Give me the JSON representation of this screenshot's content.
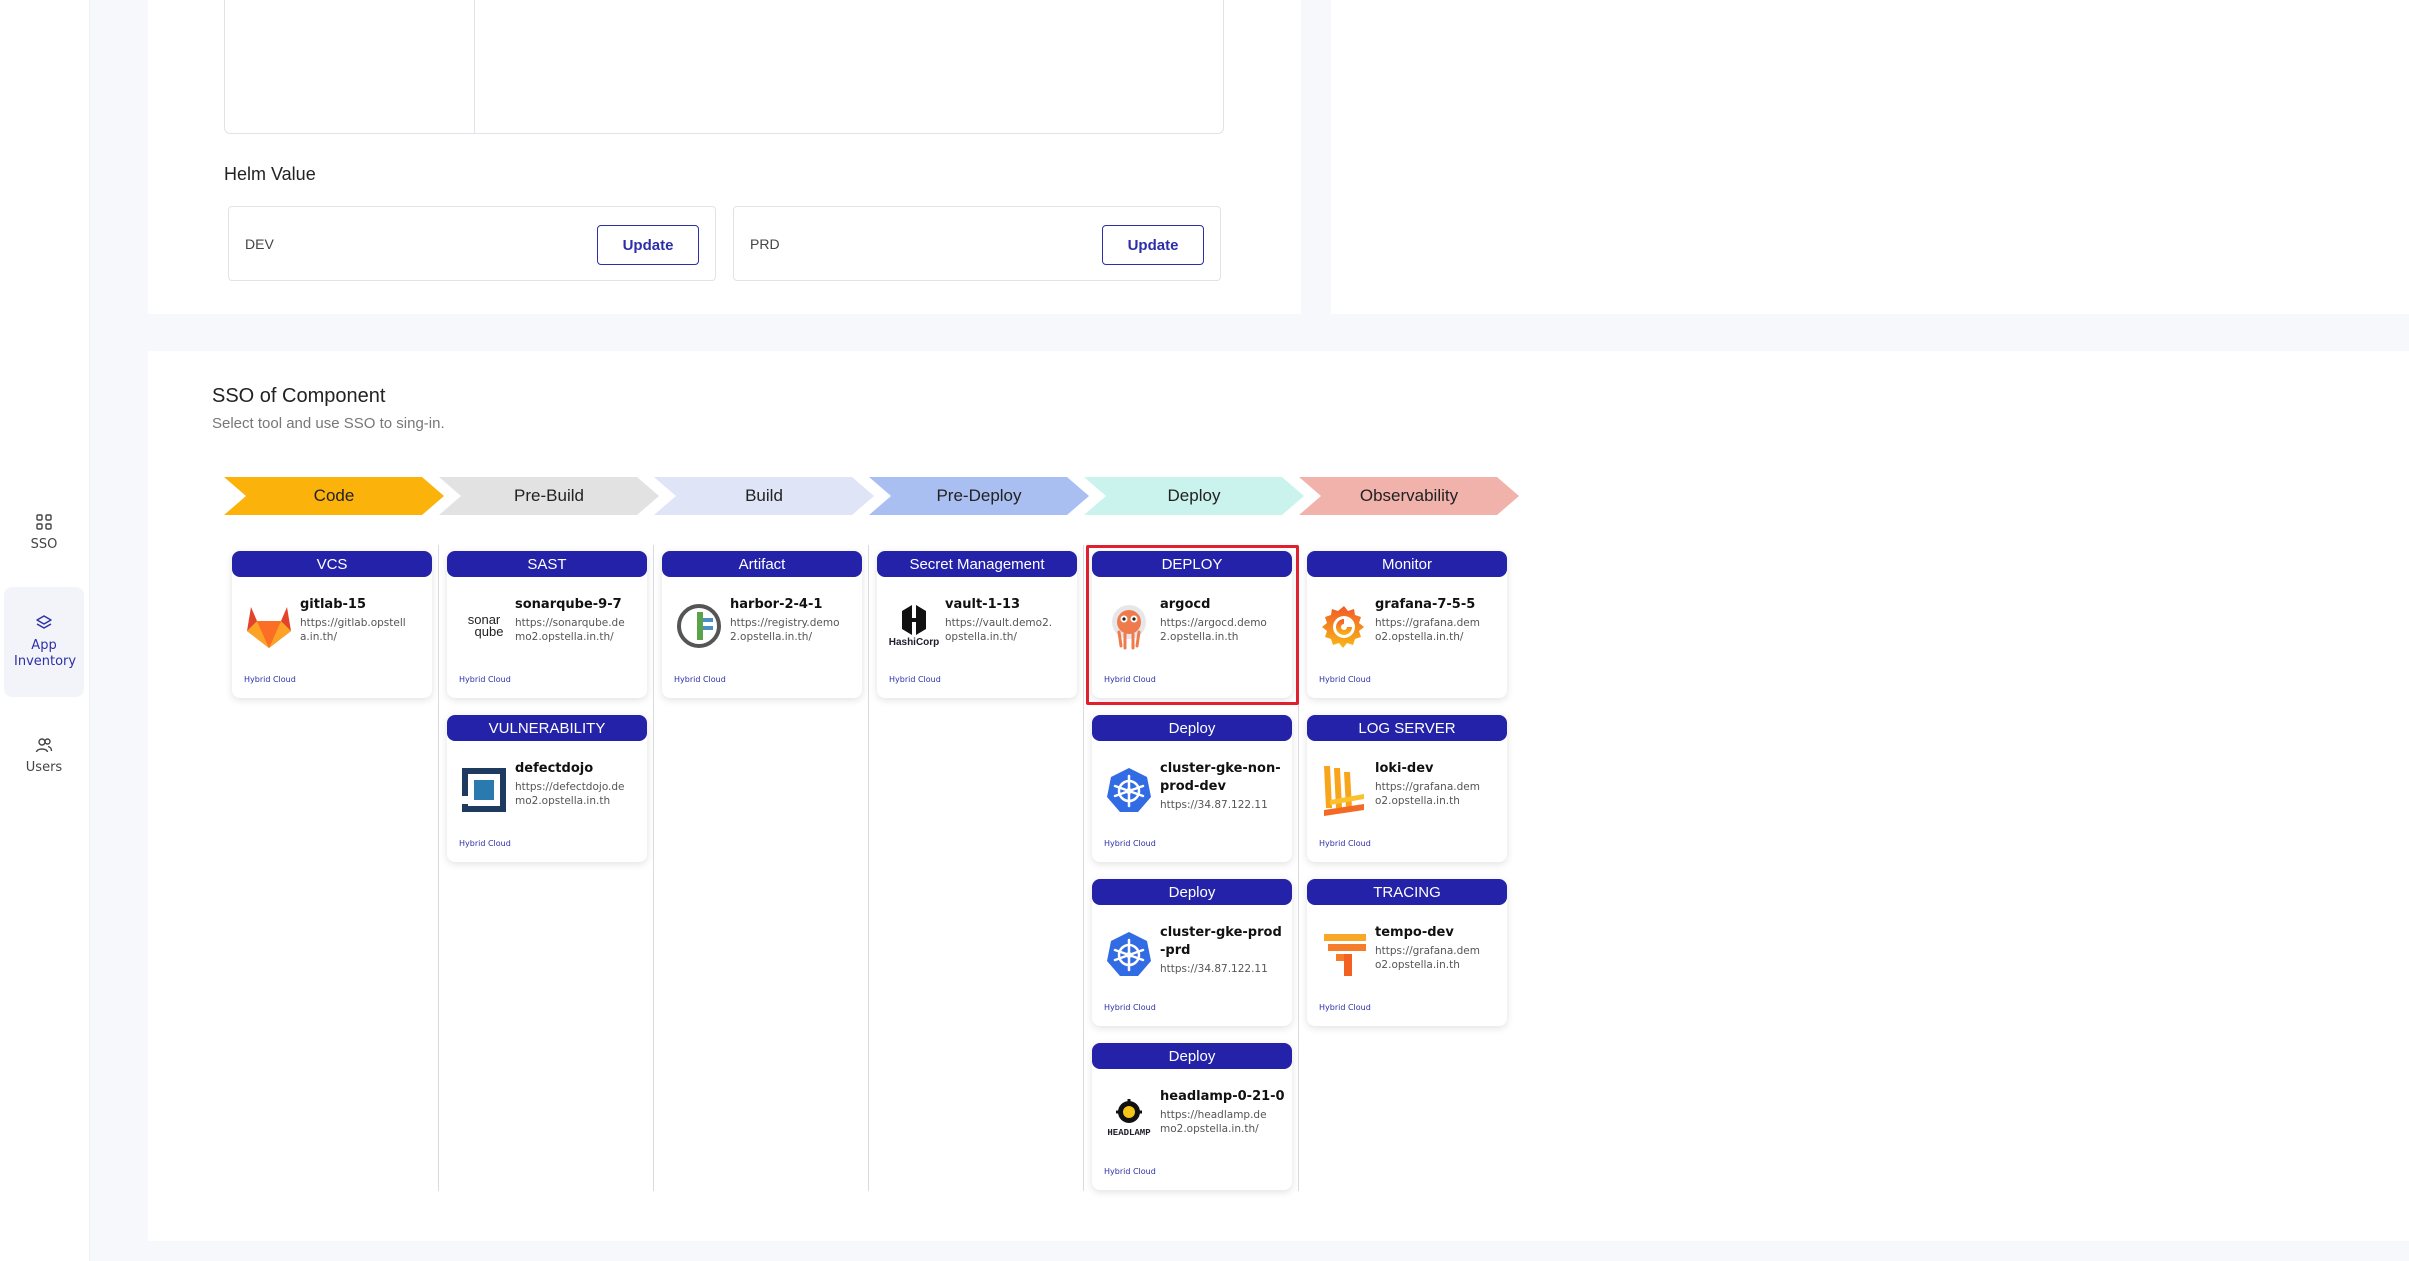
{
  "sidebar": {
    "items": [
      {
        "label": "SSO",
        "icon": "grid-icon"
      },
      {
        "label": "App Inventory",
        "icon": "layers-icon"
      },
      {
        "label": "Users",
        "icon": "users-icon"
      }
    ]
  },
  "helm": {
    "title": "Helm Value",
    "envs": [
      {
        "name": "DEV",
        "button": "Update"
      },
      {
        "name": "PRD",
        "button": "Update"
      }
    ]
  },
  "sso": {
    "title": "SSO of Component",
    "subtitle": "Select tool and use SSO to sing-in.",
    "stages": [
      {
        "label": "Code",
        "color": "#fbb30b"
      },
      {
        "label": "Pre-Build",
        "color": "#e2e2e2"
      },
      {
        "label": "Build",
        "color": "#dfe4f7"
      },
      {
        "label": "Pre-Deploy",
        "color": "#a9bff2"
      },
      {
        "label": "Deploy",
        "color": "#c9f3ec"
      },
      {
        "label": "Observability",
        "color": "#f1b2ab"
      }
    ],
    "tools": [
      {
        "category": "VCS",
        "name": "gitlab-15",
        "url": "https://gitlab.opstella.in.th/",
        "cloud": "Hybrid Cloud",
        "logo": "gitlab-icon"
      },
      {
        "category": "SAST",
        "name": "sonarqube-9-7",
        "url": "https://sonarqube.demo2.opstella.in.th/",
        "cloud": "Hybrid Cloud",
        "logo": "sonarqube-icon"
      },
      {
        "category": "VULNERABILITY",
        "name": "defectdojo",
        "url": "https://defectdojo.demo2.opstella.in.th",
        "cloud": "Hybrid Cloud",
        "logo": "defectdojo-icon"
      },
      {
        "category": "Artifact",
        "name": "harbor-2-4-1",
        "url": "https://registry.demo2.opstella.in.th/",
        "cloud": "Hybrid Cloud",
        "logo": "harbor-icon"
      },
      {
        "category": "Secret Management",
        "name": "vault-1-13",
        "url": "https://vault.demo2.opstella.in.th/",
        "cloud": "Hybrid Cloud",
        "logo": "hashicorp-icon"
      },
      {
        "category": "DEPLOY",
        "name": "argocd",
        "url": "https://argocd.demo2.opstella.in.th",
        "cloud": "Hybrid Cloud",
        "logo": "argocd-icon"
      },
      {
        "category": "Deploy",
        "name": "cluster-gke-non-prod-dev",
        "url": "https://34.87.122.11",
        "cloud": "Hybrid Cloud",
        "logo": "kubernetes-icon"
      },
      {
        "category": "Deploy",
        "name": "cluster-gke-prod-prd",
        "url": "https://34.87.122.11",
        "cloud": "Hybrid Cloud",
        "logo": "kubernetes-icon"
      },
      {
        "category": "Deploy",
        "name": "headlamp-0-21-0",
        "url": "https://headlamp.demo2.opstella.in.th/",
        "cloud": "Hybrid Cloud",
        "logo": "headlamp-icon"
      },
      {
        "category": "Monitor",
        "name": "grafana-7-5-5",
        "url": "https://grafana.demo2.opstella.in.th/",
        "cloud": "Hybrid Cloud",
        "logo": "grafana-icon"
      },
      {
        "category": "LOG SERVER",
        "name": "loki-dev",
        "url": "https://grafana.demo2.opstella.in.th",
        "cloud": "Hybrid Cloud",
        "logo": "loki-icon"
      },
      {
        "category": "TRACING",
        "name": "tempo-dev",
        "url": "https://grafana.demo2.opstella.in.th",
        "cloud": "Hybrid Cloud",
        "logo": "tempo-icon"
      }
    ],
    "logo_texts": {
      "sonar": "sonar",
      "qube": "qube",
      "hashicorp": "HashiCorp",
      "headlamp": "HEADLAMP"
    }
  }
}
